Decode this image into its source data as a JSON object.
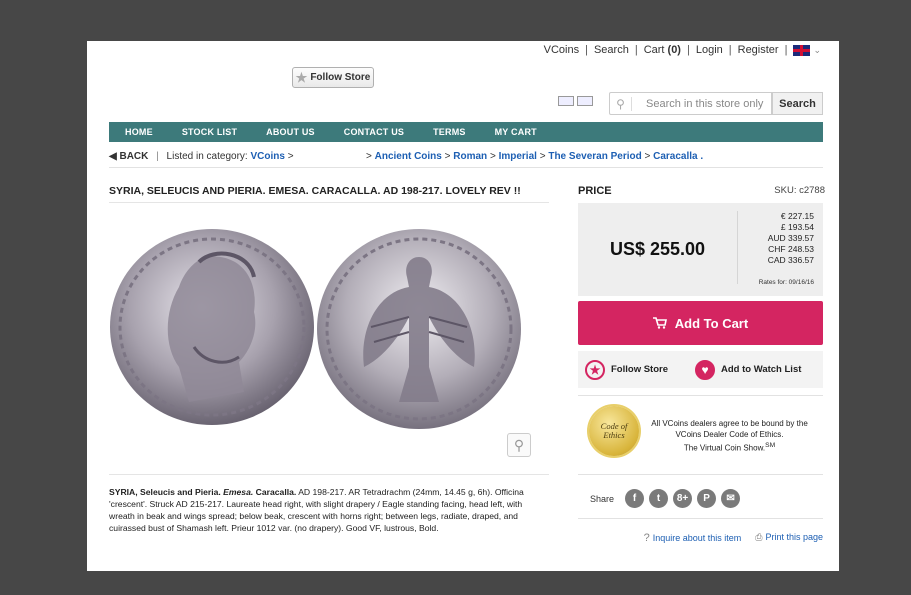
{
  "top_links": {
    "vcoins": "VCoins",
    "search": "Search",
    "cart_prefix": "Cart",
    "cart_count": "(0)",
    "login": "Login",
    "register": "Register",
    "sep": "|"
  },
  "follow_store_top": "Follow Store",
  "search": {
    "placeholder": "Search in this store only",
    "button": "Search"
  },
  "nav": [
    "HOME",
    "STOCK LIST",
    "ABOUT US",
    "CONTACT US",
    "TERMS",
    "MY CART"
  ],
  "breadcrumb": {
    "back": "BACK",
    "listed_in": "Listed in category:",
    "vcoins": "VCoins",
    "arrow1": ">",
    "path": [
      ">",
      "Ancient Coins",
      ">",
      "Roman",
      ">",
      "Imperial",
      ">",
      "The Severan Period",
      ">",
      "Caracalla",
      "."
    ]
  },
  "title": "SYRIA, SELEUCIS AND PIERIA. EMESA. CARACALLA. AD 198-217. LOVELY REV !!",
  "description": {
    "bold1": "SYRIA, Seleucis and Pieria.",
    "italic": "Emesa.",
    "bold2": "Caracalla.",
    "text": "AD 198-217. AR Tetradrachm (24mm, 14.45 g, 6h). Officina 'crescent'. Struck AD 215-217. Laureate head right, with slight drapery / Eagle standing facing, head left, with wreath in beak and wings spread; below beak, crescent with horns right; between legs, radiate, draped, and cuirassed bust of Shamash left. Prieur 1012 var. (no drapery). Good VF, lustrous, Bold."
  },
  "price": {
    "label": "PRICE",
    "sku": "SKU: c2788",
    "main": "US$ 255.00",
    "conversions": [
      "€ 227.15",
      "£ 193.54",
      "AUD 339.57",
      "CHF 248.53",
      "CAD 336.57"
    ],
    "rates": "Rates for: 09/16/16"
  },
  "add_to_cart": "Add To Cart",
  "follow_store": "Follow Store",
  "add_watch": "Add to Watch List",
  "ethics": {
    "seal_line1": "Code of",
    "seal_line2": "Ethics",
    "text1": "All VCoins dealers agree to be bound by the VCoins Dealer Code of Ethics.",
    "text2": "The Virtual Coin Show.",
    "sm": "SM"
  },
  "share": {
    "label": "Share",
    "icons": [
      "f",
      "t",
      "8+",
      "P",
      "✉"
    ]
  },
  "inquire": "Inquire about this item",
  "print": "Print this page",
  "colors": {
    "nav": "#3d7a7b",
    "accent": "#d42561",
    "link": "#1d5fb3",
    "background": "#474747"
  }
}
